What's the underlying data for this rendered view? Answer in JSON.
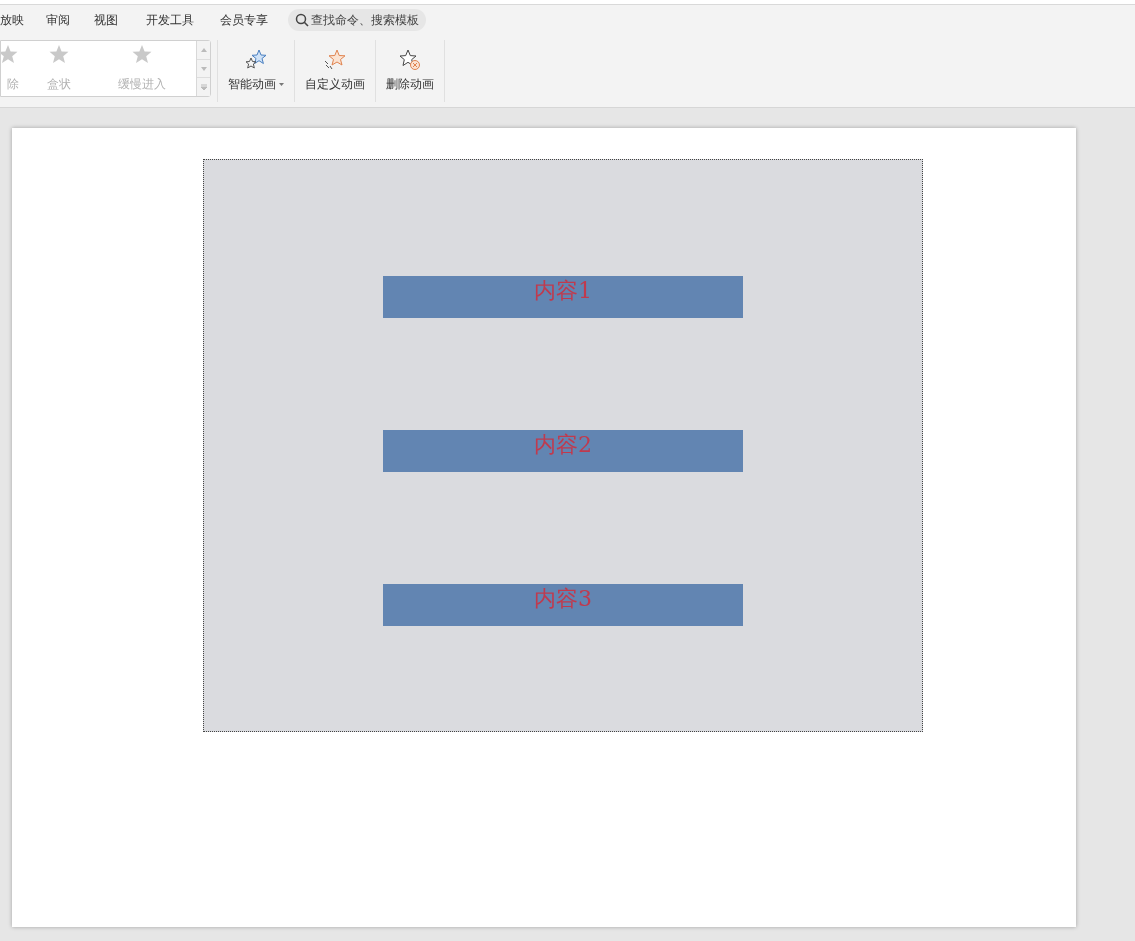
{
  "menu_tabs": [
    "放映",
    "审阅",
    "视图",
    "开发工具",
    "会员专享"
  ],
  "search": {
    "placeholder": "查找命令、搜索模板"
  },
  "animation_gallery": [
    "除",
    "盒状",
    "缓慢进入"
  ],
  "ribbon_buttons": [
    {
      "label": "智能动画",
      "kind": "dropdown"
    },
    {
      "label": "自定义动画",
      "kind": "custom"
    },
    {
      "label": "删除动画",
      "kind": "delete"
    }
  ],
  "slide": {
    "text_boxes": [
      "内容1",
      "内容2",
      "内容3"
    ]
  }
}
